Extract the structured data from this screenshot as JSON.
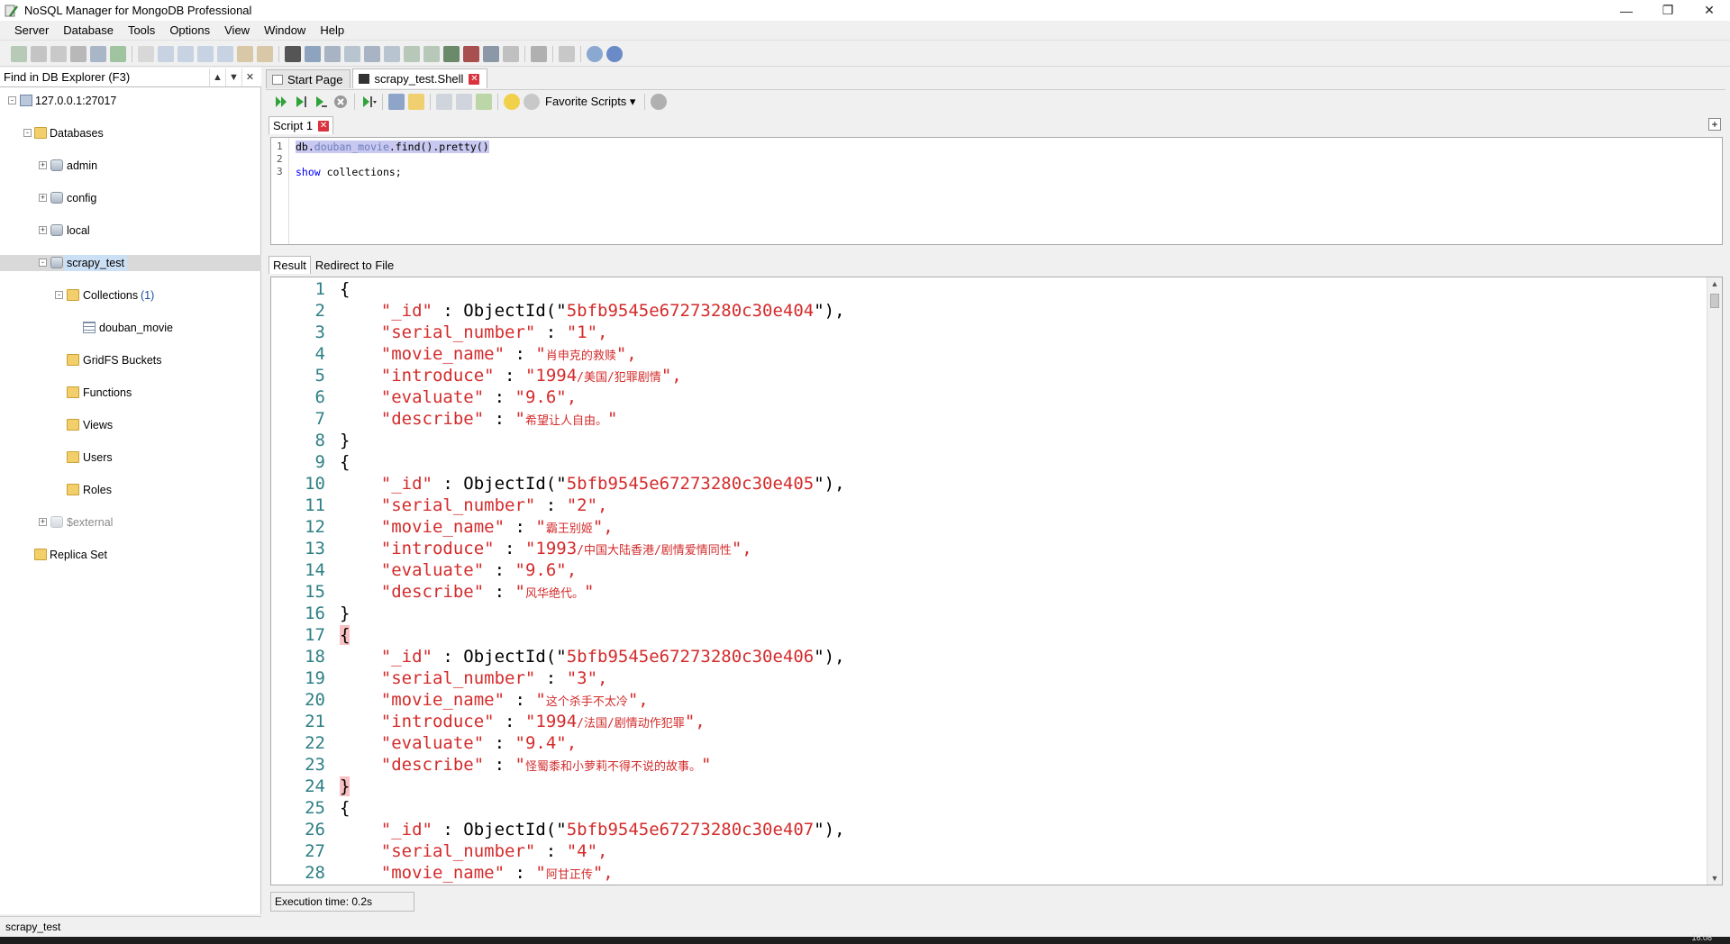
{
  "window": {
    "title": "NoSQL Manager for MongoDB Professional"
  },
  "menu": [
    "Server",
    "Database",
    "Tools",
    "Options",
    "View",
    "Window",
    "Help"
  ],
  "find": {
    "placeholder": "Find in DB Explorer (F3)"
  },
  "tree": {
    "server": "127.0.0.1:27017",
    "databases": "Databases",
    "admin": "admin",
    "config": "config",
    "local": "local",
    "scrapy_test": "scrapy_test",
    "collections": "Collections",
    "collections_count": "(1)",
    "douban_movie": "douban_movie",
    "gridfs": "GridFS Buckets",
    "functions": "Functions",
    "views": "Views",
    "users": "Users",
    "roles": "Roles",
    "external": "$external",
    "replica_set": "Replica Set"
  },
  "left_status": "scrapy_test",
  "doc_tabs": {
    "start": "Start Page",
    "shell": "scrapy_test.Shell"
  },
  "shell_toolbar": {
    "favorite_scripts": "Favorite Scripts"
  },
  "script_tab": "Script 1",
  "editor": {
    "line_numbers": [
      "1",
      "2",
      "3"
    ],
    "line1_db": "db.",
    "line1_coll": "douban_movie",
    "line1_rest": ".find().pretty()",
    "line3_kw": "show",
    "line3_rest": " collections;"
  },
  "result_tabs": {
    "result": "Result",
    "redirect": "Redirect to File"
  },
  "result": {
    "docs": [
      {
        "id": "5bfb9545e67273280c30e404",
        "serial_number": "1",
        "movie_name": "肖申克的救赎",
        "introduce_year": "1994",
        "introduce_rest": "/美国/犯罪剧情",
        "evaluate": "9.6",
        "describe": "希望让人自由。"
      },
      {
        "id": "5bfb9545e67273280c30e405",
        "serial_number": "2",
        "movie_name": "霸王别姬",
        "introduce_year": "1993",
        "introduce_rest": "/中国大陆香港/剧情爱情同性",
        "evaluate": "9.6",
        "describe": "风华绝代。"
      },
      {
        "id": "5bfb9545e67273280c30e406",
        "serial_number": "3",
        "movie_name": "这个杀手不太冷",
        "introduce_year": "1994",
        "introduce_rest": "/法国/剧情动作犯罪",
        "evaluate": "9.4",
        "describe": "怪蜀黍和小萝莉不得不说的故事。"
      },
      {
        "id": "5bfb9545e67273280c30e407",
        "serial_number": "4",
        "movie_name": "阿甘正传"
      }
    ]
  },
  "exec_status": "Execution time: 0.2s",
  "taskbar": {
    "clock": "16:08"
  }
}
